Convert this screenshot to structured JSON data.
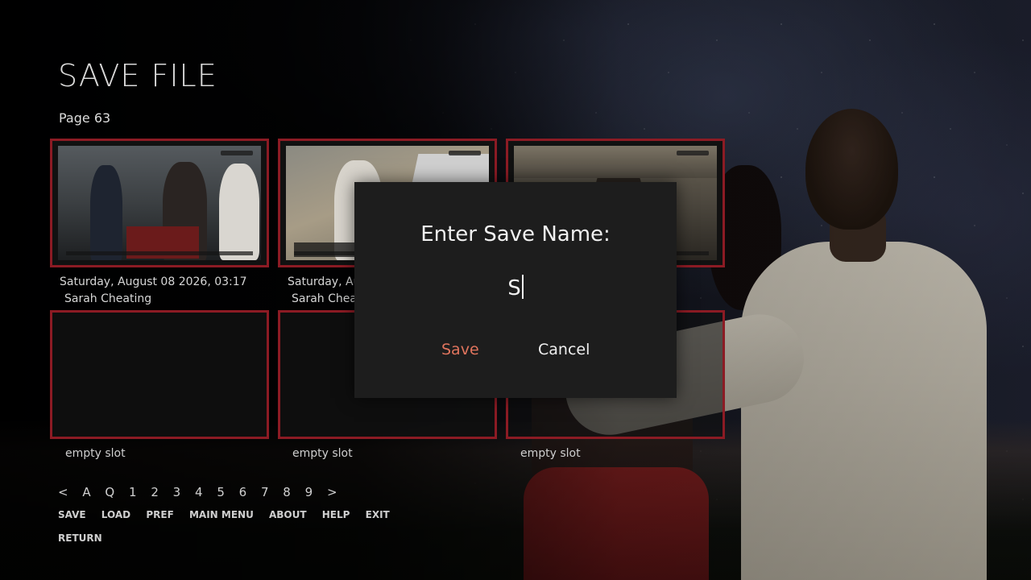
{
  "screen": {
    "title": "SAVE FILE",
    "page_label": "Page 63"
  },
  "slots": [
    {
      "date": "Saturday, August 08 2026, 03:17",
      "name": "Sarah Cheating",
      "empty": false
    },
    {
      "date": "Saturday, Au",
      "name": "Sarah Cheat",
      "empty": false
    },
    {
      "date": "",
      "name": "",
      "empty": false
    },
    {
      "empty_label": "empty slot",
      "empty": true
    },
    {
      "empty_label": "empty slot",
      "empty": true
    },
    {
      "empty_label": "empty slot",
      "empty": true
    }
  ],
  "pager": [
    "<",
    "A",
    "Q",
    "1",
    "2",
    "3",
    "4",
    "5",
    "6",
    "7",
    "8",
    "9",
    ">"
  ],
  "nav": {
    "row1": [
      "SAVE",
      "LOAD",
      "PREF",
      "MAIN MENU",
      "ABOUT",
      "HELP",
      "EXIT"
    ],
    "row2": [
      "RETURN"
    ]
  },
  "dialog": {
    "title": "Enter Save Name:",
    "input_value": "S",
    "save_label": "Save",
    "cancel_label": "Cancel"
  },
  "colors": {
    "slot_border": "#8c1b24",
    "accent_save": "#e0745d",
    "dialog_bg": "#1d1d1d"
  }
}
